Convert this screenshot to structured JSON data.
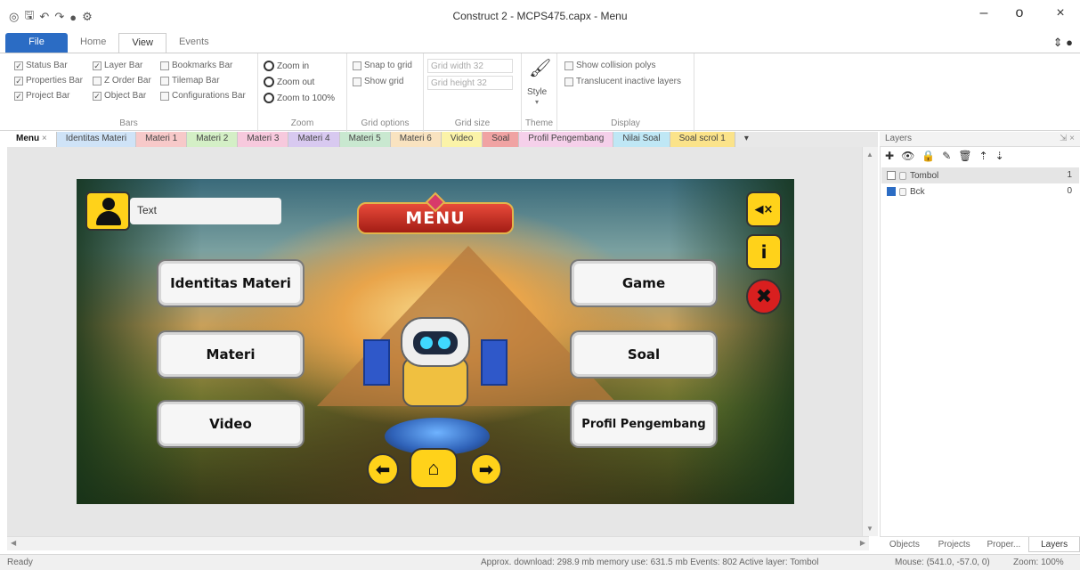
{
  "window": {
    "title": "Construct 2 - MCPS475.capx - Menu",
    "minimize_glyph": "–",
    "restore_glyph": "o",
    "close_glyph": "×"
  },
  "quick_access": [
    "save-icon",
    "undo-icon",
    "redo-icon",
    "preview-icon",
    "settings-icon"
  ],
  "ribbon": {
    "tabs": [
      {
        "label": "File"
      },
      {
        "label": "Home"
      },
      {
        "label": "View"
      },
      {
        "label": "Events"
      }
    ],
    "active_tab": "View",
    "groups": {
      "bars": {
        "label": "Bars",
        "items": [
          {
            "label": "Status Bar",
            "checked": true
          },
          {
            "label": "Properties Bar",
            "checked": true
          },
          {
            "label": "Project Bar",
            "checked": true
          },
          {
            "label": "Layer Bar",
            "checked": true
          },
          {
            "label": "Z Order Bar",
            "checked": false
          },
          {
            "label": "Object Bar",
            "checked": true
          },
          {
            "label": "Bookmarks Bar",
            "checked": false
          },
          {
            "label": "Tilemap Bar",
            "checked": false
          },
          {
            "label": "Configurations Bar",
            "checked": false
          }
        ]
      },
      "zoom": {
        "label": "Zoom",
        "items": [
          "Zoom in",
          "Zoom out",
          "Zoom to 100%"
        ]
      },
      "grid_options": {
        "label": "Grid options",
        "items": [
          {
            "label": "Snap to grid",
            "checked": false
          },
          {
            "label": "Show grid",
            "checked": false
          }
        ]
      },
      "grid_size": {
        "label": "Grid size",
        "width": "Grid width 32",
        "height": "Grid height 32"
      },
      "theme": {
        "label": "Theme",
        "button": "Style"
      },
      "display": {
        "label": "Display",
        "items": [
          {
            "label": "Show collision polys",
            "checked": false
          },
          {
            "label": "Translucent inactive layers",
            "checked": false
          }
        ]
      }
    }
  },
  "doc_tabs": [
    {
      "label": "Menu",
      "active": true,
      "color": "#ffffff",
      "closable": true
    },
    {
      "label": "Identitas Materi",
      "color": "#cfe3f7"
    },
    {
      "label": "Materi 1",
      "color": "#f7c9c9"
    },
    {
      "label": "Materi 2",
      "color": "#d4efc6"
    },
    {
      "label": "Materi 3",
      "color": "#f7c9dd"
    },
    {
      "label": "Materi 4",
      "color": "#d8c9f0"
    },
    {
      "label": "Materi 5",
      "color": "#c9e8d0"
    },
    {
      "label": "Materi 6",
      "color": "#f9e3c0"
    },
    {
      "label": "Video",
      "color": "#fbf3a8"
    },
    {
      "label": "Soal",
      "color": "#f0a3a3"
    },
    {
      "label": "Profil Pengembang",
      "color": "#f5d0ea"
    },
    {
      "label": "Nilai Soal",
      "color": "#bfe7f5"
    },
    {
      "label": "Soal scrol 1",
      "color": "#fbe38a"
    }
  ],
  "layout": {
    "name_text": "Text",
    "title": "MENU",
    "buttons_left": [
      "Identitas Materi",
      "Materi",
      "Video"
    ],
    "buttons_right": [
      "Game",
      "Soal",
      "Profil Pengembang"
    ],
    "side_buttons": [
      {
        "icon": "mute-icon",
        "glyph": "◀×"
      },
      {
        "icon": "info-icon",
        "glyph": "i"
      },
      {
        "icon": "close-icon",
        "glyph": "✖"
      }
    ],
    "nav_buttons": [
      {
        "icon": "arrow-left-icon",
        "glyph": "⬅"
      },
      {
        "icon": "home-icon",
        "glyph": "⌂"
      },
      {
        "icon": "arrow-right-icon",
        "glyph": "➡"
      }
    ]
  },
  "layers_panel": {
    "title": "Layers",
    "toolbar_icons": [
      "add-layer-icon",
      "visibility-icon",
      "lock-icon",
      "edit-icon",
      "delete-icon",
      "move-up-icon",
      "move-down-icon"
    ],
    "layers": [
      {
        "name": "Tombol",
        "visible": false,
        "index": "1",
        "selected": true
      },
      {
        "name": "Bck",
        "visible": true,
        "index": "0",
        "selected": false
      }
    ],
    "tabs": [
      "Objects",
      "Projects",
      "Proper...",
      "Layers"
    ],
    "active_tab": "Layers"
  },
  "statusbar": {
    "left": "Ready",
    "download": "Approx. download: 298.9 mb  memory use: 631.5 mb  Events: 802  Active layer: Tombol",
    "mouse": "Mouse: (541.0, -57.0, 0)",
    "zoom": "Zoom: 100%"
  }
}
